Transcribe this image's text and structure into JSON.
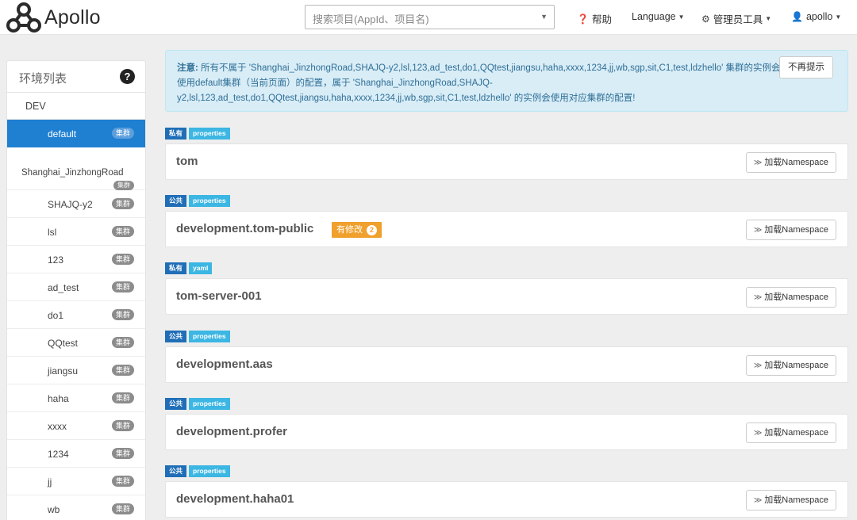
{
  "app": {
    "name": "Apollo",
    "search_placeholder": "搜索项目(AppId、项目名)"
  },
  "nav": {
    "help": "帮助",
    "language": "Language",
    "admin_tools": "管理员工具",
    "user": "apollo"
  },
  "sidebar": {
    "title": "环境列表",
    "help_glyph": "?",
    "env": "DEV",
    "default_item": {
      "label": "default",
      "badge": "集群"
    },
    "parent_cluster": {
      "label": "Shanghai_JinzhongRoad",
      "badge": "集群"
    },
    "items": [
      {
        "label": "SHAJQ-y2",
        "badge": "集群"
      },
      {
        "label": "lsl",
        "badge": "集群"
      },
      {
        "label": "123",
        "badge": "集群"
      },
      {
        "label": "ad_test",
        "badge": "集群"
      },
      {
        "label": "do1",
        "badge": "集群"
      },
      {
        "label": "QQtest",
        "badge": "集群"
      },
      {
        "label": "jiangsu",
        "badge": "集群"
      },
      {
        "label": "haha",
        "badge": "集群"
      },
      {
        "label": "xxxx",
        "badge": "集群"
      },
      {
        "label": "1234",
        "badge": "集群"
      },
      {
        "label": "jj",
        "badge": "集群"
      },
      {
        "label": "wb",
        "badge": "集群"
      }
    ]
  },
  "alert": {
    "prefix": "注意:",
    "message": " 所有不属于 'Shanghai_JinzhongRoad,SHAJQ-y2,lsl,123,ad_test,do1,QQtest,jiangsu,haha,xxxx,1234,jj,wb,sgp,sit,C1,test,ldzhello' 集群的实例会使用default集群（当前页面）的配置，属于 'Shanghai_JinzhongRoad,SHAJQ-y2,lsl,123,ad_test,do1,QQtest,jiangsu,haha,xxxx,1234,jj,wb,sgp,sit,C1,test,ldzhello' 的实例会使用对应集群的配置!",
    "dismiss_label": "不再提示"
  },
  "namespaces": [
    {
      "scope": "私有",
      "format": "properties",
      "name": "tom",
      "load_label": "加载Namespace"
    },
    {
      "scope": "公共",
      "format": "properties",
      "name": "development.tom-public",
      "modified_label": "有修改",
      "modified_count": "2",
      "load_label": "加载Namespace"
    },
    {
      "scope": "私有",
      "format": "yaml",
      "name": "tom-server-001",
      "load_label": "加载Namespace"
    },
    {
      "scope": "公共",
      "format": "properties",
      "name": "development.aas",
      "load_label": "加载Namespace"
    },
    {
      "scope": "公共",
      "format": "properties",
      "name": "development.profer",
      "load_label": "加载Namespace"
    },
    {
      "scope": "公共",
      "format": "properties",
      "name": "development.haha01",
      "load_label": "加载Namespace"
    }
  ],
  "colors": {
    "primary": "#1f7fd1",
    "scope_tag": "#1f6eb7",
    "format_tag": "#3cb6e3",
    "modified": "#f0a02c",
    "alert_bg": "#d9edf7"
  }
}
